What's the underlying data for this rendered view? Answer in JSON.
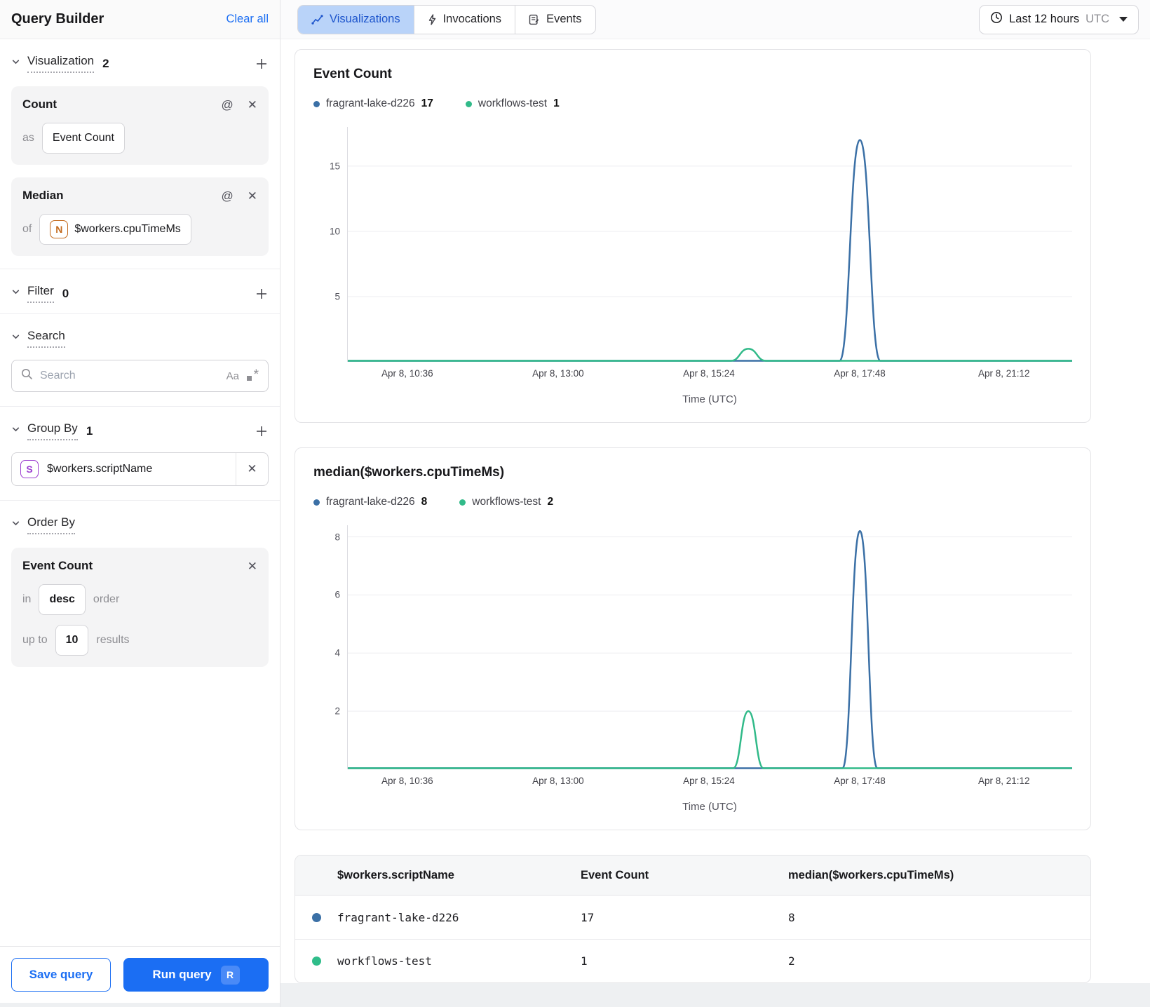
{
  "icons": {
    "at": "@",
    "close": "✕"
  },
  "sidebar": {
    "title": "Query Builder",
    "clear_all": "Clear all",
    "visualization": {
      "label": "Visualization",
      "count": "2",
      "cards": [
        {
          "title": "Count",
          "prefix": "as",
          "value": "Event Count"
        },
        {
          "title": "Median",
          "prefix": "of",
          "badge": "N",
          "value": "$workers.cpuTimeMs"
        }
      ]
    },
    "filter": {
      "label": "Filter",
      "count": "0"
    },
    "search": {
      "label": "Search",
      "placeholder": "Search",
      "case_icon": "Aa"
    },
    "group_by": {
      "label": "Group By",
      "count": "1",
      "item": {
        "badge": "S",
        "value": "$workers.scriptName"
      }
    },
    "order_by": {
      "label": "Order By",
      "card": {
        "title": "Event Count",
        "in": "in",
        "direction": "desc",
        "order": "order",
        "up_to": "up to",
        "limit": "10",
        "results": "results"
      }
    },
    "footer": {
      "save": "Save query",
      "run": "Run query",
      "run_kbd": "R"
    }
  },
  "topbar": {
    "tabs": [
      {
        "label": "Visualizations",
        "active": true
      },
      {
        "label": "Invocations",
        "active": false
      },
      {
        "label": "Events",
        "active": false
      }
    ],
    "time_range": {
      "label": "Last 12 hours",
      "zone": "UTC"
    }
  },
  "chart_data": [
    {
      "type": "line",
      "title": "Event Count",
      "xlabel": "Time (UTC)",
      "x_ticks": [
        "Apr 8, 10:36",
        "Apr 8, 13:00",
        "Apr 8, 15:24",
        "Apr 8, 17:48",
        "Apr 8, 21:12"
      ],
      "x_tick_fractions": [
        0.083,
        0.291,
        0.499,
        0.707,
        0.906
      ],
      "ymax": 18,
      "yticks": [
        5,
        10,
        15
      ],
      "grid": true,
      "legend": [
        {
          "name": "fragrant-lake-d226",
          "value": "17"
        },
        {
          "name": "workflows-test",
          "value": "1"
        }
      ],
      "series": [
        {
          "name": "fragrant-lake-d226",
          "color": "#3b70a6",
          "baseline": 0,
          "peak": {
            "x": 0.707,
            "value": 17,
            "half_width": 0.028
          }
        },
        {
          "name": "workflows-test",
          "color": "#31ba89",
          "baseline": 0,
          "peak": {
            "x": 0.553,
            "value": 1,
            "half_width": 0.024
          }
        }
      ]
    },
    {
      "type": "line",
      "title": "median($workers.cpuTimeMs)",
      "xlabel": "Time (UTC)",
      "x_ticks": [
        "Apr 8, 10:36",
        "Apr 8, 13:00",
        "Apr 8, 15:24",
        "Apr 8, 17:48",
        "Apr 8, 21:12"
      ],
      "x_tick_fractions": [
        0.083,
        0.291,
        0.499,
        0.707,
        0.906
      ],
      "ymax": 8.4,
      "yticks": [
        2,
        4,
        6,
        8
      ],
      "grid": true,
      "legend": [
        {
          "name": "fragrant-lake-d226",
          "value": "8"
        },
        {
          "name": "workflows-test",
          "value": "2"
        }
      ],
      "series": [
        {
          "name": "fragrant-lake-d226",
          "color": "#3b70a6",
          "baseline": 0,
          "peak": {
            "x": 0.707,
            "value": 8.2,
            "half_width": 0.024
          }
        },
        {
          "name": "workflows-test",
          "color": "#31ba89",
          "baseline": 0,
          "peak": {
            "x": 0.553,
            "value": 2,
            "half_width": 0.021
          }
        }
      ]
    }
  ],
  "table": {
    "headers": [
      "$workers.scriptName",
      "Event Count",
      "median($workers.cpuTimeMs)"
    ],
    "rows": [
      {
        "dot_color": "#3b70a6",
        "name": "fragrant-lake-d226",
        "event_count": "17",
        "median": "8"
      },
      {
        "dot_color": "#2fbd8a",
        "name": "workflows-test",
        "event_count": "1",
        "median": "2"
      }
    ]
  },
  "colors": {
    "accent_blue": "#1b6ef3",
    "series_blue": "#3b70a6",
    "series_green": "#31ba89",
    "tab_active_bg": "#b9d3f9"
  }
}
